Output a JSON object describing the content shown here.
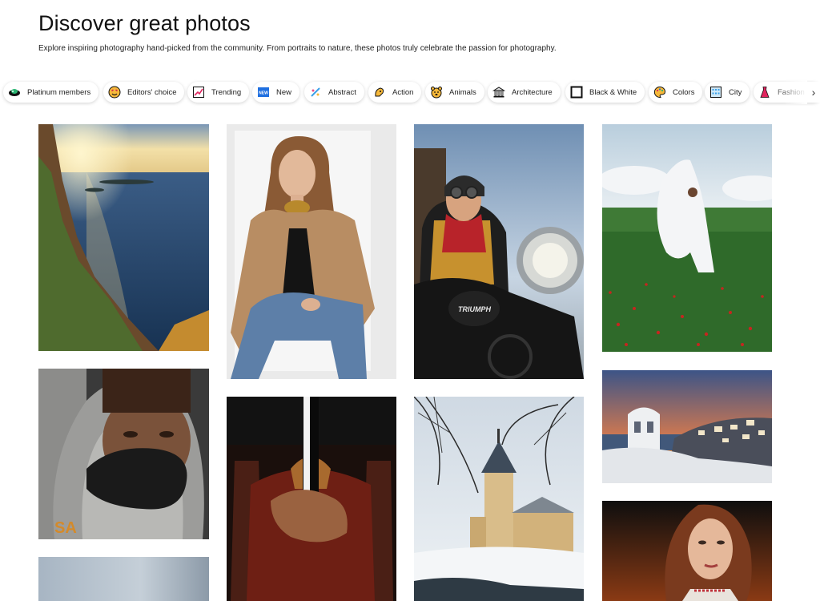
{
  "header": {
    "title": "Discover great photos",
    "subtitle": "Explore inspiring photography hand-picked from the community. From portraits to nature, these photos truly celebrate the passion for photography."
  },
  "categories": [
    {
      "label": "Platinum members",
      "icon": "platinum-icon"
    },
    {
      "label": "Editors' choice",
      "icon": "editors-choice-icon"
    },
    {
      "label": "Trending",
      "icon": "trending-icon"
    },
    {
      "label": "New",
      "icon": "new-icon"
    },
    {
      "label": "Abstract",
      "icon": "abstract-icon"
    },
    {
      "label": "Action",
      "icon": "action-icon"
    },
    {
      "label": "Animals",
      "icon": "animals-icon"
    },
    {
      "label": "Architecture",
      "icon": "architecture-icon"
    },
    {
      "label": "Black & White",
      "icon": "black-white-icon"
    },
    {
      "label": "Colors",
      "icon": "colors-icon"
    },
    {
      "label": "City",
      "icon": "city-icon"
    },
    {
      "label": "Fashion",
      "icon": "fashion-icon"
    }
  ],
  "photos": [
    {
      "subject": "sea-cliff-sunset"
    },
    {
      "subject": "woman-beige-blazer-portrait"
    },
    {
      "subject": "motorcycle-rider-goggles"
    },
    {
      "subject": "woman-white-dress-field"
    },
    {
      "subject": "man-hood-black-mask"
    },
    {
      "subject": "hands-on-red-chair"
    },
    {
      "subject": "winter-castle-tower"
    },
    {
      "subject": "santorini-sunset"
    },
    {
      "subject": "woman-red-hair-portrait"
    },
    {
      "subject": "grey-blue-photo"
    }
  ]
}
